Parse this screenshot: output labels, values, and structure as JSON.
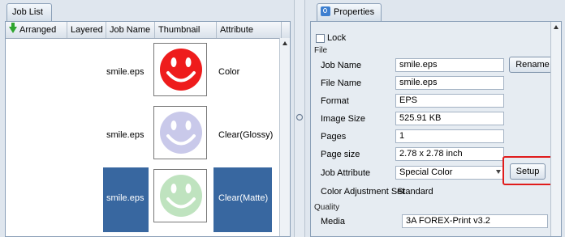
{
  "job_list": {
    "tab_label": "Job List",
    "columns": [
      "Arranged",
      "Layered",
      "Job Name",
      "Thumbnail",
      "Attribute"
    ],
    "rows": [
      {
        "job_name": "smile.eps",
        "attribute": "Color",
        "face_color": "#ee1c1c",
        "selected": false
      },
      {
        "job_name": "smile.eps",
        "attribute": "Clear(Glossy)",
        "face_color": "#c9c9ea",
        "selected": false
      },
      {
        "job_name": "smile.eps",
        "attribute": "Clear(Matte)",
        "face_color": "#bfe3bf",
        "selected": true
      }
    ]
  },
  "properties": {
    "tab_label": "Properties",
    "lock_label": "Lock",
    "file_section": "File",
    "fields": {
      "job_name_label": "Job Name",
      "job_name_value": "smile.eps",
      "file_name_label": "File Name",
      "file_name_value": "smile.eps",
      "format_label": "Format",
      "format_value": "EPS",
      "image_size_label": "Image Size",
      "image_size_value": "525.91 KB",
      "pages_label": "Pages",
      "pages_value": "1",
      "page_size_label": "Page size",
      "page_size_value": "2.78 x 2.78 inch",
      "job_attribute_label": "Job Attribute",
      "job_attribute_value": "Special Color",
      "color_adjustment_label": "Color Adjustment Set",
      "color_adjustment_value": "Standard"
    },
    "rename_button": "Rename",
    "setup_button": "Setup",
    "quality_section": "Quality",
    "media_label": "Media",
    "media_value": "3A FOREX-Print v3.2"
  },
  "colors": {
    "selection": "#3867a0",
    "highlight": "#e01b1b"
  }
}
